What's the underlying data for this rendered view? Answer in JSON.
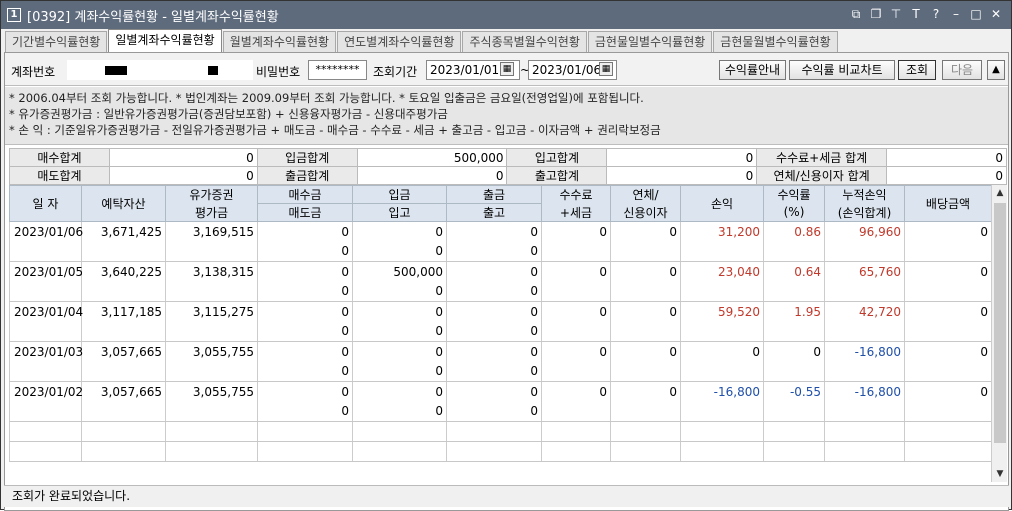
{
  "window": {
    "num": "1",
    "title": "[0392] 계좌수익률현황 - 일별계좌수익률현황"
  },
  "tabs": [
    {
      "label": "기간별수익률현황",
      "active": false
    },
    {
      "label": "일별계좌수익률현황",
      "active": true
    },
    {
      "label": "월별계좌수익률현황",
      "active": false
    },
    {
      "label": "연도별계좌수익률현황",
      "active": false
    },
    {
      "label": "주식종목별월수익현황",
      "active": false
    },
    {
      "label": "금현물일별수익률현황",
      "active": false
    },
    {
      "label": "금현물월별수익률현황",
      "active": false
    }
  ],
  "cond": {
    "account_label": "계좌번호",
    "password_label": "비밀번호",
    "password_value": "********",
    "period_label": "조회기간",
    "date_from": "2023/01/01",
    "tilde": "~",
    "date_to": "2023/01/06",
    "guide_button": "수익률안내",
    "compare_button": "수익률 비교차트",
    "query_button": "조회",
    "next_button": "다음"
  },
  "notes": [
    "* 2006.04부터 조회 가능합니다.   * 법인계좌는 2009.09부터 조회 가능합니다.   * 토요일 입출금은 금요일(전영업일)에 포함됩니다.",
    "* 유가증권평가금 : 일반유가증권평가금(증권담보포함) + 신용융자평가금 - 신용대주평가금",
    "* 손         익 : 기준일유가증권평가금 - 전일유가증권평가금 + 매도금 - 매수금 - 수수료 - 세금 + 출고금 - 입고금 - 이자금액 + 권리락보정금"
  ],
  "summary": {
    "buy_total_label": "매수합계",
    "buy_total": "0",
    "deposit_total_label": "입금합계",
    "deposit_total": "500,000",
    "in_total_label": "입고합계",
    "in_total": "0",
    "fee_tax_label": "수수료+세금 합계",
    "fee_tax": "0",
    "sell_total_label": "매도합계",
    "sell_total": "0",
    "withdraw_total_label": "출금합계",
    "withdraw_total": "0",
    "out_total_label": "출고합계",
    "out_total": "0",
    "overdue_label": "연체/신용이자 합계",
    "overdue": "0"
  },
  "grid": {
    "headers": {
      "date": "일 자",
      "deposit_assets": "예탁자산",
      "securities_1": "유가증권",
      "securities_2": "평가금",
      "buy": "매수금",
      "sell": "매도금",
      "deposit": "입금",
      "stock_in": "입고",
      "withdraw": "출금",
      "stock_out": "출고",
      "fee_1": "수수료",
      "fee_2": "+세금",
      "overdue_1": "연체/",
      "overdue_2": "신용이자",
      "pnl": "손익",
      "rate_1": "수익률",
      "rate_2": "(%)",
      "cum_1": "누적손익",
      "cum_2": "(손익합계)",
      "dividend": "배당금액"
    },
    "rows": [
      {
        "date": "2023/01/06",
        "assets": "3,671,425",
        "securities": "3,169,515",
        "buy": "0",
        "sell": "0",
        "deposit": "0",
        "stock_in": "0",
        "withdraw": "0",
        "stock_out": "0",
        "fee": "0",
        "overdue": "0",
        "pnl": "31,200",
        "rate": "0.86",
        "cum": "96,960",
        "dividend": "0",
        "pnl_color": "red",
        "rate_color": "red",
        "cum_color": "red"
      },
      {
        "date": "2023/01/05",
        "assets": "3,640,225",
        "securities": "3,138,315",
        "buy": "0",
        "sell": "0",
        "deposit": "500,000",
        "stock_in": "0",
        "withdraw": "0",
        "stock_out": "0",
        "fee": "0",
        "overdue": "0",
        "pnl": "23,040",
        "rate": "0.64",
        "cum": "65,760",
        "dividend": "0",
        "pnl_color": "red",
        "rate_color": "red",
        "cum_color": "red"
      },
      {
        "date": "2023/01/04",
        "assets": "3,117,185",
        "securities": "3,115,275",
        "buy": "0",
        "sell": "0",
        "deposit": "0",
        "stock_in": "0",
        "withdraw": "0",
        "stock_out": "0",
        "fee": "0",
        "overdue": "0",
        "pnl": "59,520",
        "rate": "1.95",
        "cum": "42,720",
        "dividend": "0",
        "pnl_color": "red",
        "rate_color": "red",
        "cum_color": "red"
      },
      {
        "date": "2023/01/03",
        "assets": "3,057,665",
        "securities": "3,055,755",
        "buy": "0",
        "sell": "0",
        "deposit": "0",
        "stock_in": "0",
        "withdraw": "0",
        "stock_out": "0",
        "fee": "0",
        "overdue": "0",
        "pnl": "0",
        "rate": "0",
        "cum": "-16,800",
        "dividend": "0",
        "pnl_color": "black",
        "rate_color": "black",
        "cum_color": "blue"
      },
      {
        "date": "2023/01/02",
        "assets": "3,057,665",
        "securities": "3,055,755",
        "buy": "0",
        "sell": "0",
        "deposit": "0",
        "stock_in": "0",
        "withdraw": "0",
        "stock_out": "0",
        "fee": "0",
        "overdue": "0",
        "pnl": "-16,800",
        "rate": "-0.55",
        "cum": "-16,800",
        "dividend": "0",
        "pnl_color": "blue",
        "rate_color": "blue",
        "cum_color": "blue"
      }
    ]
  },
  "status": "조회가 완료되었습니다.",
  "colors": {
    "titlebar": "#5e6b7d",
    "header": "#dce5ef",
    "positive": "#c0392b",
    "negative": "#1f4fa8"
  }
}
